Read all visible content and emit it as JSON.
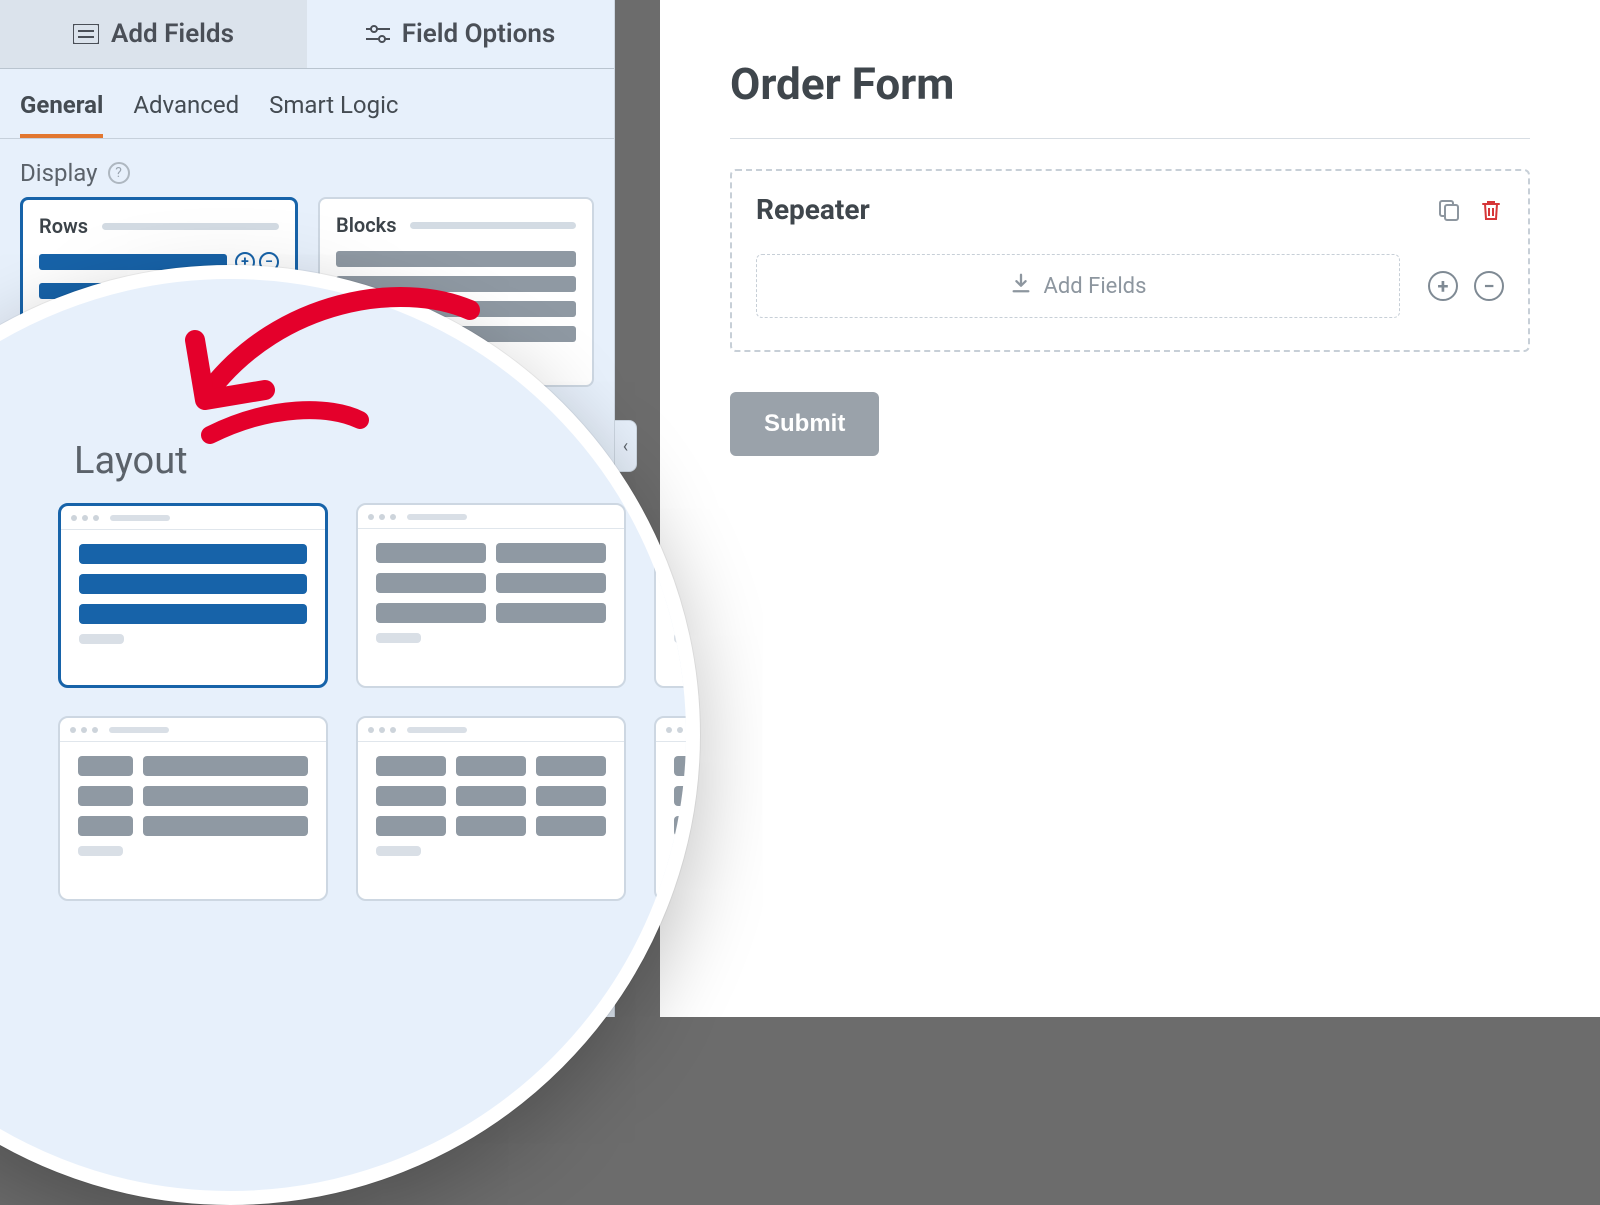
{
  "topTabs": {
    "addFields": "Add Fields",
    "fieldOptions": "Field Options"
  },
  "secTabs": {
    "general": "General",
    "advanced": "Advanced",
    "smartLogic": "Smart Logic"
  },
  "sections": {
    "display": "Display",
    "layout": "Layout"
  },
  "display": {
    "rows": "Rows",
    "blocks": "Blocks"
  },
  "form": {
    "title": "Order Form",
    "repeaterTitle": "Repeater",
    "addFields": "Add Fields",
    "submit": "Submit"
  },
  "icons": {
    "help": "?",
    "plus": "+",
    "minus": "−",
    "collapse": "‹"
  },
  "colors": {
    "accent": "#1763a9",
    "orange": "#e27730",
    "danger": "#d63638",
    "panel": "#e7f0fb"
  }
}
